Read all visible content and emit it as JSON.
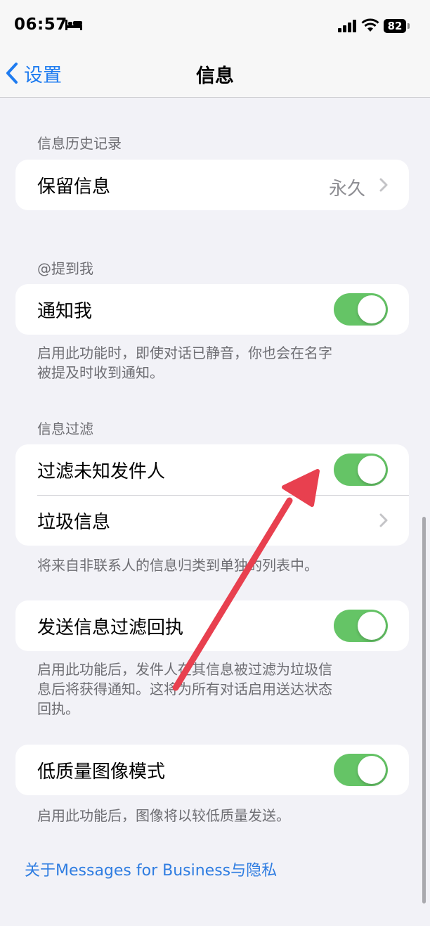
{
  "status_bar": {
    "time": "06:57",
    "battery": "82"
  },
  "nav": {
    "back_label": "设置",
    "title": "信息"
  },
  "sections": {
    "history": {
      "header": "信息历史记录",
      "keep_label": "保留信息",
      "keep_value": "永久"
    },
    "mentions": {
      "header": "@提到我",
      "notify_label": "通知我",
      "notify_on": true,
      "footer_lines": [
        "启用此功能时，即使对话已静音，你也会在名字",
        "被提及时收到通知。"
      ]
    },
    "filtering": {
      "header": "信息过滤",
      "filter_label": "过滤未知发件人",
      "filter_on": true,
      "junk_label": "垃圾信息",
      "footer": "将来自非联系人的信息归类到单独的列表中。"
    },
    "receipts": {
      "label": "发送信息过滤回执",
      "on": true,
      "footer_lines": [
        "启用此功能后，发件人在其信息被过滤为垃圾信",
        "息后将获得通知。这将为所有对话启用送达状态",
        "回执。"
      ]
    },
    "low_quality": {
      "label": "低质量图像模式",
      "on": true,
      "footer": "启用此功能后，图像将以较低质量发送。"
    }
  },
  "link": "关于Messages for Business与隐私",
  "colors": {
    "accent": "#1f7cf0",
    "toggle_on": "#65c466",
    "annotation_arrow": "#e8404f"
  }
}
